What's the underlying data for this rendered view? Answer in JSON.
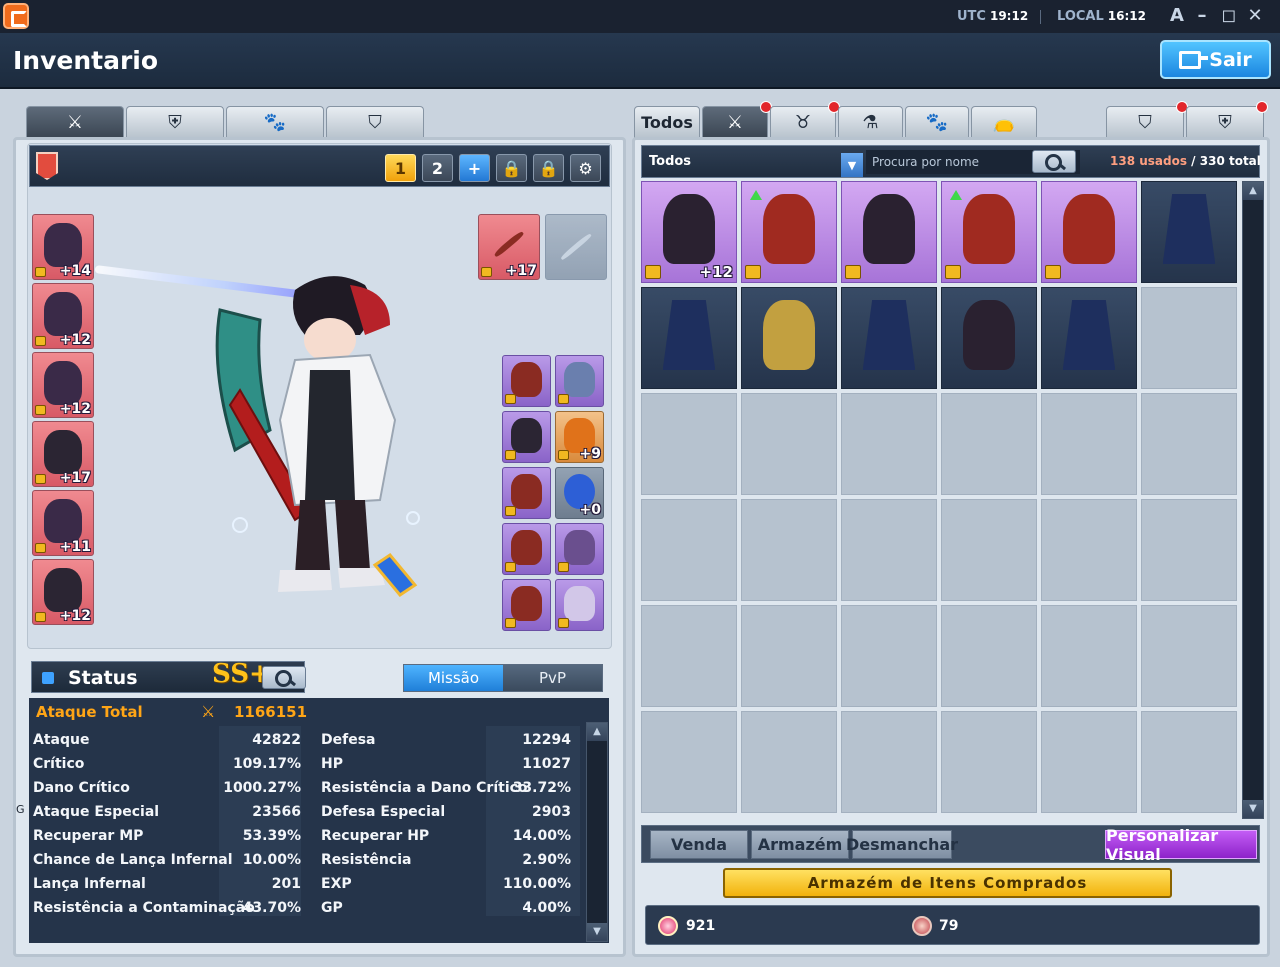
{
  "clock": {
    "utc_label": "UTC",
    "utc_time": "19:12",
    "local_label": "LOCAL",
    "local_time": "16:12"
  },
  "window_controls": {
    "font": "A",
    "minimize": "–",
    "maximize": "◻",
    "close": "✕"
  },
  "header": {
    "title": "Inventario",
    "exit_label": "Sair"
  },
  "equipment": {
    "toolbar": {
      "preset_1": "1",
      "preset_2": "2",
      "add": "+"
    },
    "left_slots": [
      {
        "level": "+14"
      },
      {
        "level": "+12"
      },
      {
        "level": "+12"
      },
      {
        "level": "+17"
      },
      {
        "level": "+11"
      },
      {
        "level": "+12"
      }
    ],
    "weapon_slot": {
      "level": "+17"
    },
    "accessory_slots": [
      {
        "level": ""
      },
      {
        "level": ""
      },
      {
        "level": ""
      },
      {
        "level": "+9"
      },
      {
        "level": ""
      },
      {
        "level": "+0"
      },
      {
        "level": ""
      },
      {
        "level": ""
      },
      {
        "level": ""
      },
      {
        "level": ""
      }
    ]
  },
  "status": {
    "title": "Status",
    "rank": "SS+",
    "tabs": {
      "mission": "Missão",
      "pvp": "PvP"
    },
    "total_attack_label": "Ataque Total",
    "total_attack_value": "1166151",
    "left_stats": [
      {
        "label": "Ataque",
        "value": "42822"
      },
      {
        "label": "Crítico",
        "value": "109.17%"
      },
      {
        "label": "Dano Crítico",
        "value": "1000.27%"
      },
      {
        "label": "Ataque Especial",
        "value": "23566"
      },
      {
        "label": "Recuperar MP",
        "value": "53.39%"
      },
      {
        "label": "Chance de Lança Infernal",
        "value": "10.00%"
      },
      {
        "label": "Lança Infernal",
        "value": "201"
      },
      {
        "label": "Resistência a Contaminação",
        "value": "43.70%"
      }
    ],
    "right_stats": [
      {
        "label": "Defesa",
        "value": "12294"
      },
      {
        "label": "HP",
        "value": "11027"
      },
      {
        "label": "Resistência a Dano Crítico",
        "value": "33.72%"
      },
      {
        "label": "Defesa Especial",
        "value": "2903"
      },
      {
        "label": "Recuperar HP",
        "value": "14.00%"
      },
      {
        "label": "Resistência",
        "value": "2.90%"
      },
      {
        "label": "EXP",
        "value": "110.00%"
      },
      {
        "label": "GP",
        "value": "4.00%"
      }
    ],
    "edge_mark": "G"
  },
  "inventory": {
    "tabs": {
      "all": "Todos"
    },
    "filter": {
      "selected": "Todos",
      "search_placeholder": "Procura por nome"
    },
    "usage": {
      "used": "138 usados",
      "total": " / 330 total"
    },
    "items": [
      {
        "level": "+12"
      },
      {
        "level": ""
      },
      {
        "level": ""
      },
      {
        "level": ""
      },
      {
        "level": ""
      },
      {
        "level": ""
      },
      {
        "level": ""
      },
      {
        "level": ""
      },
      {
        "level": ""
      },
      {
        "level": ""
      },
      {
        "level": ""
      }
    ],
    "actions": {
      "sell": "Venda",
      "storage": "Armazém",
      "dismantle": "Desmanchar",
      "customize": "Personalizar Visual"
    },
    "purchased_storage": "Armazém de Itens Comprados",
    "currency": {
      "gems": "921",
      "coins": "79"
    }
  },
  "colors": {
    "accent": "#2a8ae8",
    "total_attack": "#ffa516",
    "lock": "#f1b920",
    "notification": "#e2262b"
  }
}
